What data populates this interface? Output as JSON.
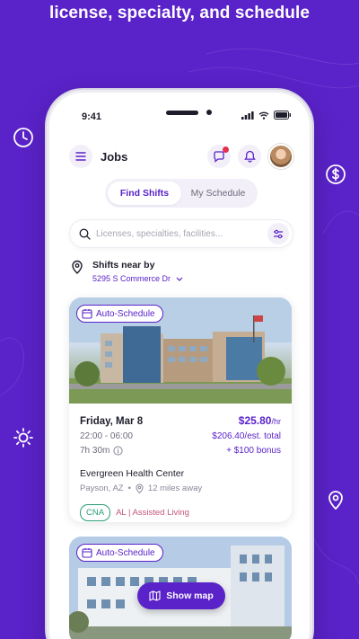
{
  "hero": {
    "title": "license, specialty, and schedule"
  },
  "status": {
    "time": "9:41"
  },
  "header": {
    "title": "Jobs"
  },
  "tabs": [
    {
      "label": "Find Shifts",
      "active": true
    },
    {
      "label": "My Schedule",
      "active": false
    }
  ],
  "search": {
    "placeholder": "Licenses, specialties, facilities..."
  },
  "location": {
    "label": "Shifts near by",
    "address": "5295 S Commerce Dr"
  },
  "shifts": [
    {
      "badge": "Auto-Schedule",
      "date": "Friday, Mar 8",
      "rate": "$25.80",
      "rate_unit": "/hr",
      "time": "22:00 - 06:00",
      "est_total": "$206.40/est. total",
      "duration": "7h 30m",
      "bonus": "+ $100 bonus",
      "facility": "Evergreen Health Center",
      "city": "Payson, AZ",
      "distance": "12 miles away",
      "license": "CNA",
      "specialty": "AL | Assisted Living"
    },
    {
      "badge": "Auto-Schedule"
    }
  ],
  "map_button": {
    "label": "Show map"
  },
  "colors": {
    "accent": "#5a22c9",
    "tag_green": "#2a9d77",
    "tag_pink": "#c2567e"
  }
}
